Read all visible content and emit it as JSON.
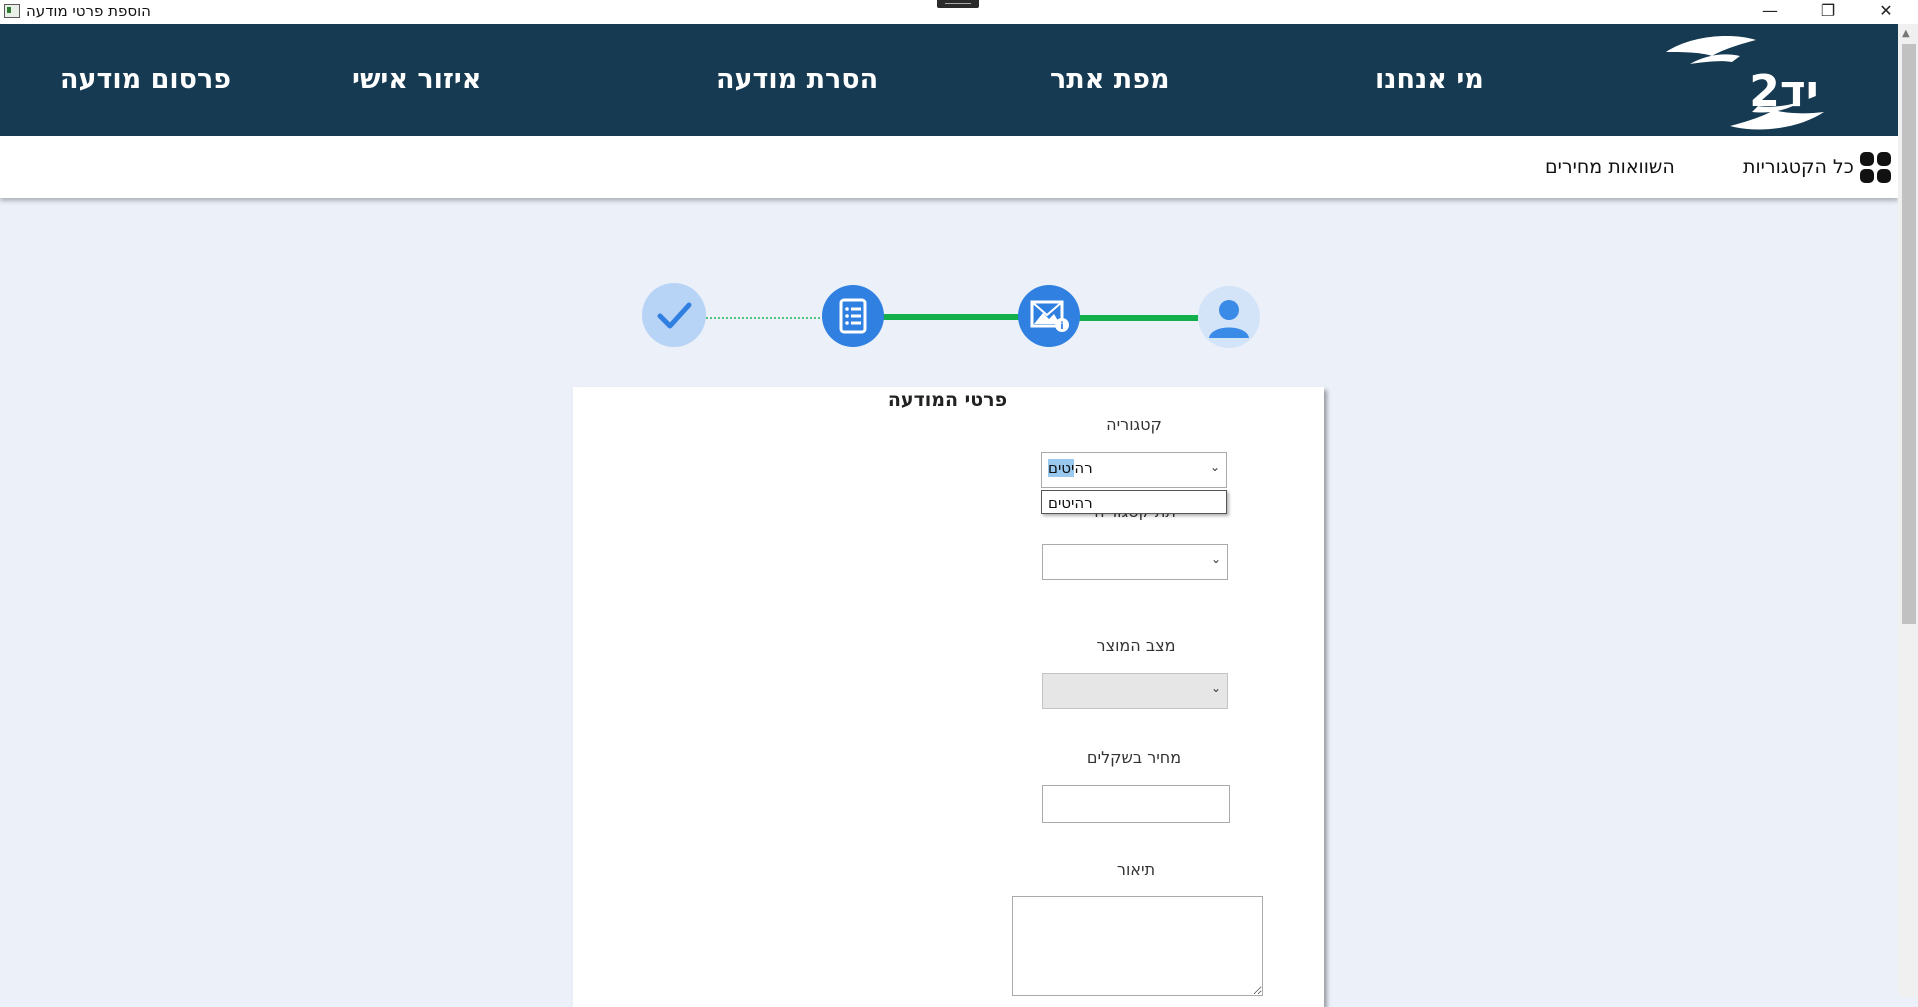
{
  "window": {
    "title": "הוספת פרטי מודעה",
    "minimize_glyph": "—",
    "restore_glyph": "❐",
    "close_glyph": "✕"
  },
  "header": {
    "logo_text": "יד2",
    "nav": {
      "about": "מי אנחנו",
      "sitemap": "מפת אתר",
      "remove_ad": "הסרת מודעה",
      "personal_area": "איזור אישי",
      "publish_ad": "פרסום מודעה"
    }
  },
  "subheader": {
    "all_categories": "כל הקטגוריות",
    "price_compare": "השוואות מחירים"
  },
  "stepper": {
    "steps": [
      {
        "name": "user",
        "state": "current"
      },
      {
        "name": "ad-info",
        "state": "active"
      },
      {
        "name": "details",
        "state": "active"
      },
      {
        "name": "done",
        "state": "pending"
      }
    ],
    "colors": {
      "active": "#2f80e0",
      "pending": "#b7d3f5",
      "line_done": "#12b04a"
    }
  },
  "form": {
    "title": "פרטי המודעה",
    "category": {
      "label": "קטגוריה",
      "value_highlight": "יטים",
      "value_rest": "רה",
      "options": [
        "רהיטים"
      ]
    },
    "subcategory": {
      "label": "תת קטגוריה",
      "value": ""
    },
    "condition": {
      "label": "מצב המוצר",
      "value": ""
    },
    "price": {
      "label": "מחיר בשקלים",
      "value": ""
    },
    "description": {
      "label": "תיאור",
      "value": ""
    }
  }
}
